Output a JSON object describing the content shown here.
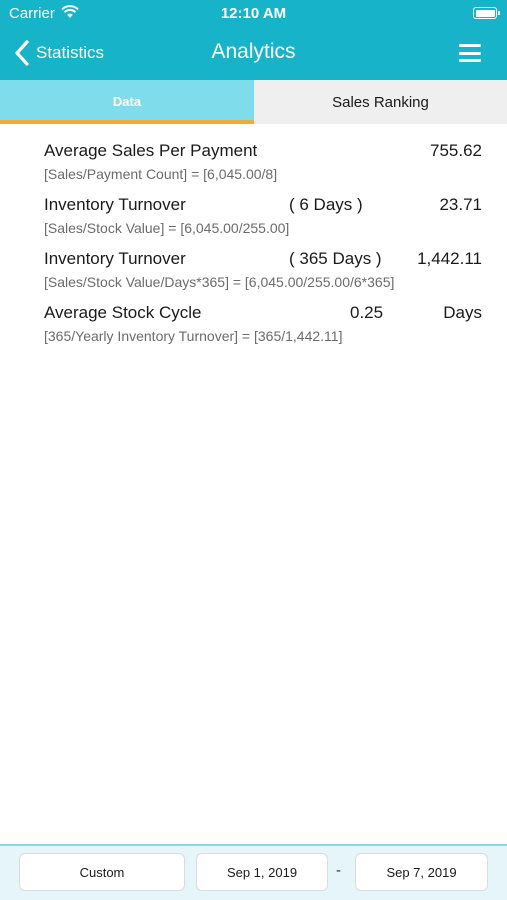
{
  "status_bar": {
    "carrier": "Carrier",
    "time": "12:10 AM"
  },
  "nav": {
    "back_label": "Statistics",
    "title": "Analytics"
  },
  "tabs": [
    {
      "label": "Data",
      "active": true
    },
    {
      "label": "Sales Ranking",
      "active": false
    }
  ],
  "metrics": [
    {
      "label": "Average Sales Per Payment",
      "middle": "",
      "value": "755.62",
      "formula": "[Sales/Payment Count] = [6,045.00/8]"
    },
    {
      "label": "Inventory Turnover",
      "middle": "( 6 Days )",
      "value": "23.71",
      "formula": "[Sales/Stock Value] = [6,045.00/255.00]"
    },
    {
      "label": "Inventory Turnover",
      "middle": "( 365 Days )",
      "value": "1,442.11",
      "formula": "[Sales/Stock Value/Days*365] = [6,045.00/255.00/6*365]"
    },
    {
      "label": "Average Stock Cycle",
      "middle": "0.25",
      "value": "Days",
      "formula": "[365/Yearly Inventory Turnover] = [365/1,442.11]"
    }
  ],
  "footer": {
    "range_label": "Custom",
    "start_date": "Sep 1, 2019",
    "separator": "-",
    "end_date": "Sep 7, 2019"
  },
  "colors": {
    "header": "#17b3c9",
    "tab_active_bg": "#7fdceb",
    "tab_indicator": "#f4a73a"
  }
}
